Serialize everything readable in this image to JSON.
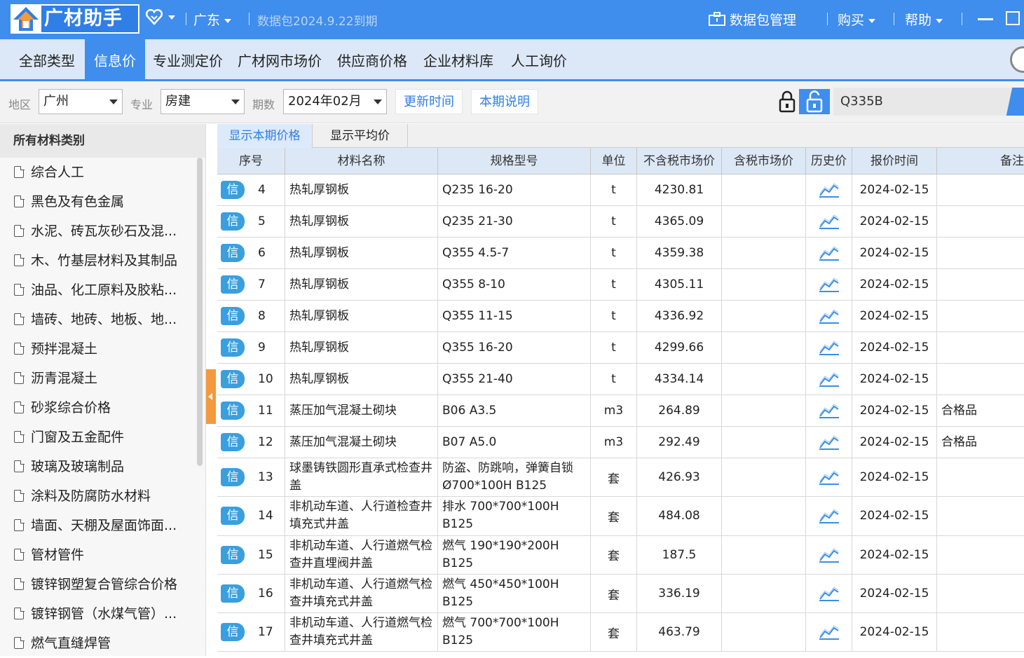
{
  "app": {
    "title": "广材助手",
    "region": "广东",
    "expiry": "数据包2024.9.22到期",
    "menu_package": "数据包管理",
    "menu_buy": "购买",
    "menu_help": "帮助"
  },
  "tabs": [
    "全部类型",
    "信息价",
    "专业测定价",
    "广材网市场价",
    "供应商价格",
    "企业材料库",
    "人工询价"
  ],
  "filters": {
    "region_label": "地区",
    "region_value": "广州",
    "major_label": "专业",
    "major_value": "房建",
    "period_label": "期数",
    "period_value": "2024年02月",
    "update_time_btn": "更新时间",
    "period_note_btn": "本期说明",
    "search_value": "Q335B"
  },
  "sidebar": {
    "header": "所有材料类别",
    "items": [
      "综合人工",
      "黑色及有色金属",
      "水泥、砖瓦灰砂石及混...",
      "木、竹基层材料及其制品",
      "油品、化工原料及胶粘...",
      "墙砖、地砖、地板、地...",
      "预拌混凝土",
      "沥青混凝土",
      "砂浆综合价格",
      "门窗及五金配件",
      "玻璃及玻璃制品",
      "涂料及防腐防水材料",
      "墙面、天棚及屋面饰面...",
      "管材管件",
      "镀锌钢塑复合管综合价格",
      "镀锌钢管（水煤气管）...",
      "燃气直缝焊管"
    ]
  },
  "subtabs": [
    "显示本期价格",
    "显示平均价"
  ],
  "table": {
    "headers": [
      "序号",
      "材料名称",
      "规格型号",
      "单位",
      "不含税市场价",
      "含税市场价",
      "历史价",
      "报价时间",
      "备注"
    ],
    "badge": "信",
    "rows": [
      {
        "no": "4",
        "name": "热轧厚钢板",
        "spec": "Q235 16-20",
        "unit": "t",
        "price": "4230.81",
        "tax_price": "",
        "date": "2024-02-15",
        "note": ""
      },
      {
        "no": "5",
        "name": "热轧厚钢板",
        "spec": "Q235 21-30",
        "unit": "t",
        "price": "4365.09",
        "tax_price": "",
        "date": "2024-02-15",
        "note": ""
      },
      {
        "no": "6",
        "name": "热轧厚钢板",
        "spec": "Q355 4.5-7",
        "unit": "t",
        "price": "4359.38",
        "tax_price": "",
        "date": "2024-02-15",
        "note": ""
      },
      {
        "no": "7",
        "name": "热轧厚钢板",
        "spec": "Q355 8-10",
        "unit": "t",
        "price": "4305.11",
        "tax_price": "",
        "date": "2024-02-15",
        "note": ""
      },
      {
        "no": "8",
        "name": "热轧厚钢板",
        "spec": "Q355 11-15",
        "unit": "t",
        "price": "4336.92",
        "tax_price": "",
        "date": "2024-02-15",
        "note": ""
      },
      {
        "no": "9",
        "name": "热轧厚钢板",
        "spec": "Q355 16-20",
        "unit": "t",
        "price": "4299.66",
        "tax_price": "",
        "date": "2024-02-15",
        "note": ""
      },
      {
        "no": "10",
        "name": "热轧厚钢板",
        "spec": "Q355 21-40",
        "unit": "t",
        "price": "4334.14",
        "tax_price": "",
        "date": "2024-02-15",
        "note": ""
      },
      {
        "no": "11",
        "name": "蒸压加气混凝土砌块",
        "spec": "B06 A3.5",
        "unit": "m3",
        "price": "264.89",
        "tax_price": "",
        "date": "2024-02-15",
        "note": "合格品"
      },
      {
        "no": "12",
        "name": "蒸压加气混凝土砌块",
        "spec": "B07 A5.0",
        "unit": "m3",
        "price": "292.49",
        "tax_price": "",
        "date": "2024-02-15",
        "note": "合格品"
      },
      {
        "no": "13",
        "name": "球墨铸铁圆形直承式检查井盖",
        "spec": "防盗、防跳响，弹簧自锁 Ø700*100H  B125",
        "unit": "套",
        "price": "426.93",
        "tax_price": "",
        "date": "2024-02-15",
        "note": ""
      },
      {
        "no": "14",
        "name": "非机动车道、人行道检查井填充式井盖",
        "spec": "排水  700*700*100H B125",
        "unit": "套",
        "price": "484.08",
        "tax_price": "",
        "date": "2024-02-15",
        "note": ""
      },
      {
        "no": "15",
        "name": "非机动车道、人行道燃气检查井直埋阀井盖",
        "spec": "燃气  190*190*200H B125",
        "unit": "套",
        "price": "187.5",
        "tax_price": "",
        "date": "2024-02-15",
        "note": ""
      },
      {
        "no": "16",
        "name": "非机动车道、人行道燃气检查井填充式井盖",
        "spec": "燃气  450*450*100H B125",
        "unit": "套",
        "price": "336.19",
        "tax_price": "",
        "date": "2024-02-15",
        "note": ""
      },
      {
        "no": "17",
        "name": "非机动车道、人行道燃气检查井填充式井盖",
        "spec": "燃气  700*700*100H B125",
        "unit": "套",
        "price": "463.79",
        "tax_price": "",
        "date": "2024-02-15",
        "note": ""
      }
    ]
  },
  "colors": {
    "accent": "#3f8ded",
    "badge": "#3a9fdf",
    "handle": "#f29a3d"
  }
}
